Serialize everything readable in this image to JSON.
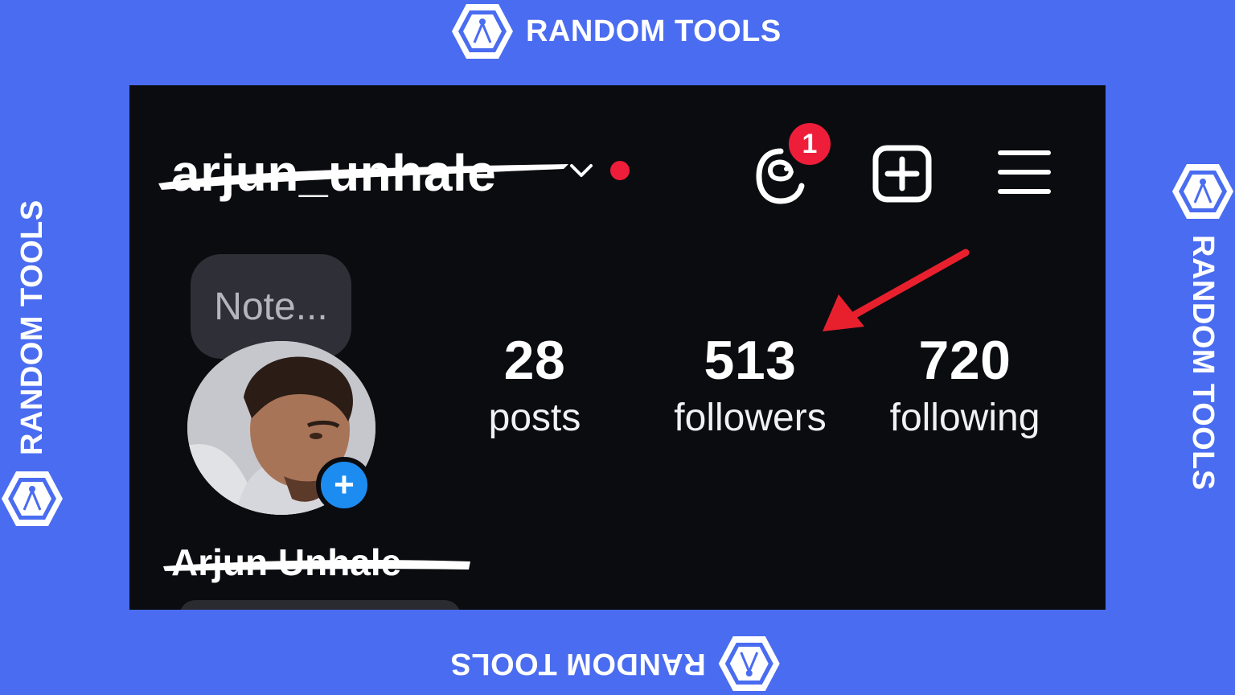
{
  "watermark": {
    "brand": "RANDOM TOOLS",
    "icon": "compass-hexagon-logo"
  },
  "profile": {
    "username": "arjun_unhale",
    "threads_badge": "1",
    "note_placeholder": "Note...",
    "full_name": "Arjun Unhale"
  },
  "stats": [
    {
      "value": "28",
      "label": "posts"
    },
    {
      "value": "513",
      "label": "followers"
    },
    {
      "value": "720",
      "label": "following"
    }
  ],
  "icons": {
    "dropdown": "chevron-down-icon",
    "notification": "red-dot-icon",
    "threads": "threads-icon",
    "create": "plus-square-icon",
    "menu": "hamburger-menu-icon",
    "add_story": "plus-circle-icon",
    "annotation": "red-arrow-icon"
  },
  "colors": {
    "background": "#4a6cf0",
    "screen": "#0b0c10",
    "accent_red": "#ee1d3a",
    "accent_blue": "#1d8cf0"
  }
}
